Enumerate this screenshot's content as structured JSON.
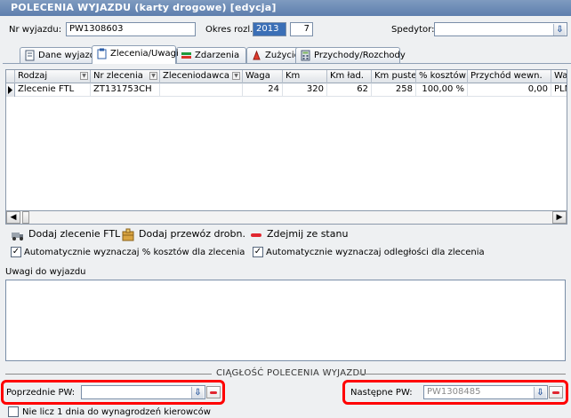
{
  "window": {
    "title": "POLECENIA WYJAZDU (karty drogowe)  [edycja]"
  },
  "header": {
    "nr_label": "Nr wyjazdu:",
    "nr_value": "PW1308603",
    "okres_label": "Okres rozl.:",
    "okres_year": "2013",
    "okres_month": "7",
    "spedytor_label": "Spedytor:",
    "spedytor_value": ""
  },
  "tabs": [
    {
      "label": "Dane wyjazdu",
      "icon": "document-icon"
    },
    {
      "label": "Zlecenia/Uwagi",
      "icon": "clipboard-icon"
    },
    {
      "label": "Zdarzenia",
      "icon": "events-icon"
    },
    {
      "label": "Zużycie",
      "icon": "fuel-icon"
    },
    {
      "label": "Przychody/Rozchody",
      "icon": "calculator-icon"
    }
  ],
  "grid": {
    "columns": [
      "Rodzaj",
      "Nr zlecenia",
      "Zleceniodawca",
      "Waga",
      "Km",
      "Km ład.",
      "Km puste",
      "% kosztów",
      "Przychód wewn.",
      "Wal"
    ],
    "rows": [
      [
        "Zlecenie FTL",
        "ZT131753CH",
        "",
        "24",
        "320",
        "62",
        "258",
        "100,00 %",
        "0,00",
        "PLN"
      ]
    ]
  },
  "actions": {
    "add_ftl": "Dodaj zlecenie FTL",
    "add_small": "Dodaj przewóz drobn.",
    "remove": "Zdejmij ze stanu"
  },
  "options": {
    "auto_costs": "Automatycznie wyznaczaj % kosztów dla zlecenia",
    "auto_distance": "Automatycznie wyznaczaj odległości dla zlecenia"
  },
  "notes": {
    "label": "Uwagi do wyjazdu",
    "value": ""
  },
  "continuity": {
    "title": "CIĄGŁOŚĆ POLECENIA WYJAZDU",
    "prev_label": "Poprzednie PW:",
    "prev_value": "",
    "next_label": "Następne PW:",
    "next_value": "PW1308485",
    "skip_label": "Nie licz 1 dnia do wynagrodzeń kierowców"
  },
  "colors": {
    "title_bar": "#6b89b5",
    "highlight": "#ff0000",
    "selection": "#3b6fb6"
  }
}
